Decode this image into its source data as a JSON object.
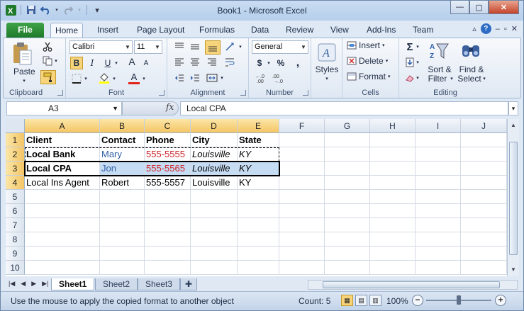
{
  "window": {
    "title": "Book1 - Microsoft Excel",
    "controls": {
      "minimize": "—",
      "maximize": "▢",
      "close": "✕"
    }
  },
  "qat": {
    "customize": "▾"
  },
  "tabs": [
    "Home",
    "Insert",
    "Page Layout",
    "Formulas",
    "Data",
    "Review",
    "View",
    "Add-Ins",
    "Team"
  ],
  "file_tab": "File",
  "tab_right": {
    "help": "?",
    "minimize_ribbon": "▵"
  },
  "ribbon": {
    "clipboard": {
      "label": "Clipboard",
      "paste": "Paste"
    },
    "font": {
      "label": "Font",
      "font_name": "Calibri",
      "font_size": "11",
      "bold": "B",
      "italic": "I",
      "underline": "U",
      "grow": "A",
      "shrink": "A",
      "font_color": "A"
    },
    "alignment": {
      "label": "Alignment"
    },
    "number": {
      "label": "Number",
      "format": "General",
      "currency": "$",
      "percent": "%",
      "comma": ","
    },
    "styles": {
      "label": "Styles"
    },
    "cells": {
      "label": "Cells",
      "insert": "Insert",
      "delete": "Delete",
      "format": "Format"
    },
    "editing": {
      "label": "Editing",
      "sum": "Σ",
      "sort": "Sort &",
      "sort2": "Filter",
      "find": "Find &",
      "find2": "Select"
    }
  },
  "formula_bar": {
    "name_box": "A3",
    "fx": "fx",
    "value": "Local CPA"
  },
  "columns": [
    "A",
    "B",
    "C",
    "D",
    "E",
    "F",
    "G",
    "H",
    "I",
    "J"
  ],
  "rows": [
    "1",
    "2",
    "3",
    "4",
    "5",
    "6",
    "7",
    "8",
    "9",
    "10"
  ],
  "sheet": {
    "r1": [
      "Client",
      "Contact",
      "Phone",
      "City",
      "State"
    ],
    "r2": [
      "Local Bank",
      "Mary",
      "555-5555",
      "Louisville",
      "KY"
    ],
    "r3": [
      "Local CPA",
      "Jon",
      "555-5565",
      "Louisville",
      "KY"
    ],
    "r4": [
      "Local Ins Agent",
      "Robert",
      "555-5557",
      "Louisville",
      "KY"
    ]
  },
  "sheet_tabs": [
    "Sheet1",
    "Sheet2",
    "Sheet3"
  ],
  "status": {
    "message": "Use the mouse to apply the copied format to another object",
    "count": "Count: 5",
    "zoom": "100%",
    "zoom_value": 100
  }
}
